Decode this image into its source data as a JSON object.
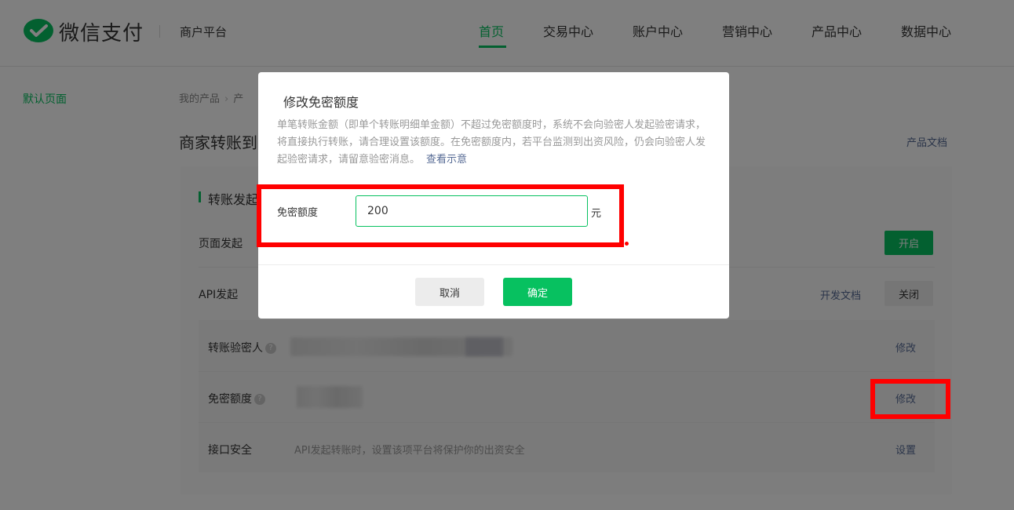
{
  "header": {
    "brand": "微信支付",
    "subtitle": "商户平台",
    "nav": [
      "首页",
      "交易中心",
      "账户中心",
      "营销中心",
      "产品中心",
      "数据中心"
    ],
    "active_nav": "首页"
  },
  "left_menu": {
    "item": "默认页面"
  },
  "breadcrumb": {
    "first": "我的产品",
    "second": "产"
  },
  "page": {
    "title": "商家转账到",
    "doc_link": "产品文档"
  },
  "section": {
    "title": "转账发起"
  },
  "rows": {
    "page_launch": {
      "label": "页面发起",
      "button": "开启"
    },
    "api_launch": {
      "label": "API发起",
      "doc_link": "开发文档",
      "button": "关闭"
    },
    "verifier": {
      "label": "转账验密人",
      "action": "修改"
    },
    "limit": {
      "label": "免密额度",
      "action": "修改"
    },
    "security": {
      "label": "接口安全",
      "note": "API发起转账时，设置该项平台将保护你的出资安全",
      "action": "设置"
    }
  },
  "modal": {
    "title": "修改免密额度",
    "description": "单笔转账金额（即单个转账明细单金额）不超过免密额度时，系统不会向验密人发起验密请求，将直接执行转账，请合理设置该额度。在免密额度内，若平台监测到出资风险，仍会向验密人发起验密请求，请留意验密消息。",
    "view_example": "查看示意",
    "field_label": "免密额度",
    "field_value": "200",
    "unit": "元",
    "cancel": "取消",
    "confirm": "确定"
  },
  "colors": {
    "brand_green": "#07c160",
    "link_blue": "#576b95",
    "annotation_red": "#ff0000"
  },
  "icons": [
    "wechat-pay-logo-icon",
    "chevron-right-icon",
    "help-icon"
  ]
}
